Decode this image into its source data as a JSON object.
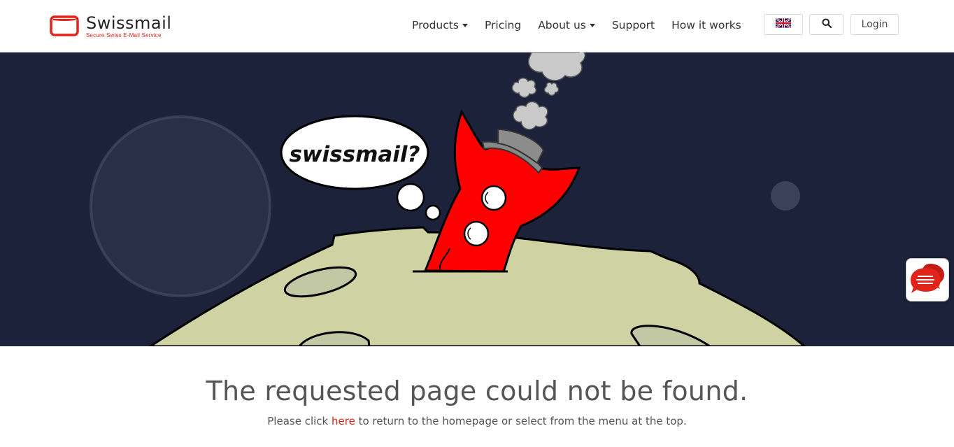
{
  "brand": {
    "name": "Swissmail",
    "tagline": "Secure Swiss E-Mail Service",
    "accent_color": "#e2231a"
  },
  "nav": {
    "items": [
      {
        "label": "Products",
        "dropdown": true
      },
      {
        "label": "Pricing",
        "dropdown": false
      },
      {
        "label": "About us",
        "dropdown": true
      },
      {
        "label": "Support",
        "dropdown": false
      },
      {
        "label": "How it works",
        "dropdown": false
      }
    ],
    "language_icon": "uk-flag-icon",
    "search_icon": "search-icon",
    "login_label": "Login"
  },
  "hero": {
    "thought_bubble_text": "swissmail?",
    "background_color": "#1c2239",
    "moon_color": "#cfd3a3",
    "mascot_color": "#ff0000"
  },
  "chat_widget": {
    "icon": "chat-bubble-icon"
  },
  "content": {
    "title": "The requested page could not be found.",
    "subtitle_before": "Please click ",
    "subtitle_link": "here",
    "subtitle_after": " to return to the homepage or select from the menu at the top."
  }
}
